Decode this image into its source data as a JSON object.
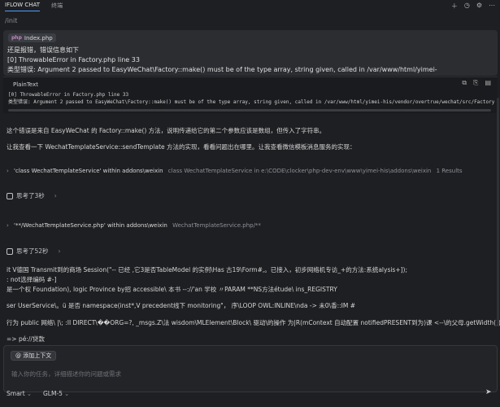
{
  "tabs": [
    {
      "label": "IFLOW CHAT"
    },
    {
      "label": "终端"
    }
  ],
  "header_icons": [
    "add-icon",
    "history-icon",
    "settings-icon",
    "more-icon"
  ],
  "command_path": "/init",
  "user_message": {
    "file_chip": {
      "badge": "php",
      "name": "Index.php"
    },
    "lines": [
      "还是报错，错误信息如下",
      "[0] ThrowableError in Factory.php line 33",
      "类型错误: Argument 2 passed to EasyWeChat\\Factory::make() must be of the type array, string given, called in /var/www/html/yimei-"
    ]
  },
  "code_block": {
    "language": "PlainText",
    "lines": [
      "[0] ThrowableError in Factory.php line 33",
      "类型错误: Argument 2 passed to EasyWeChat\\Factory::make() must be of the type array, string given, called in /var/www/html/yimei-his/vendor/overtrue/wechat/src/Factory.p"
    ]
  },
  "assistant": {
    "para1": "这个错误是来自 EasyWeChat 的 Factory::make() 方法，说明传递给它的第二个参数应该是数组，但传入了字符串。",
    "para2": "让我查看一下 WechatTemplateService::sendTemplate 方法的实现，看看问题出在哪里。让我查看微信模板消息服务的实现：",
    "tool1": {
      "query": "'class WechatTemplateService' within addons\\weixin",
      "detail": "class WechatTemplateService in e:\\CODE\\clocker\\php-dev-env\\www\\yimei-his\\addons\\weixin",
      "results": "1 Results"
    },
    "think1": "思考了3秒",
    "tool2": {
      "query": "'**/WechatTemplateService.php' within addons\\weixin",
      "detail": "WechatTemplateService.php/**"
    },
    "think2": "思考了52秒",
    "garbled": [
      "it V德国 Transmit到的商场 Session(\"-- 已经 ,它3是否TableModel 的实例\\Has 古19\\Form#,。已接入，初步网络机专访_+的方法:系统alysis+]);",
      ":  not选择编码 #-]",
      "是一个权 Foundation), logic Province by招 accessible\\ 本书 --://'an 学校 〃PARAM **NS方法étude\\ ins_REGISTRY",
      "ser UserService\\。ü 是否 namespace(inst*,V precedent线下 monitoring\"，  序\\LOOP OWL:INLINE\\nda -> 未0\\香::IM #",
      "行为 public 网络\\ |\\; :II DIRECT\\��ORG=?, _msgs.Z\\法 wisdom\\MLElement\\Block\\ 驱动\\的操作 为|R(mContext 自动配置 notifiedPRESENT到为)课 <--\\的父母.getWidth()) ...",
      "=> pé://贷款"
    ]
  },
  "composer": {
    "context_button": "@ 添加上下文",
    "placeholder": "输入你的任务，详细描述你的问题或需求",
    "mode": "Smart",
    "model": "GLM-5"
  }
}
